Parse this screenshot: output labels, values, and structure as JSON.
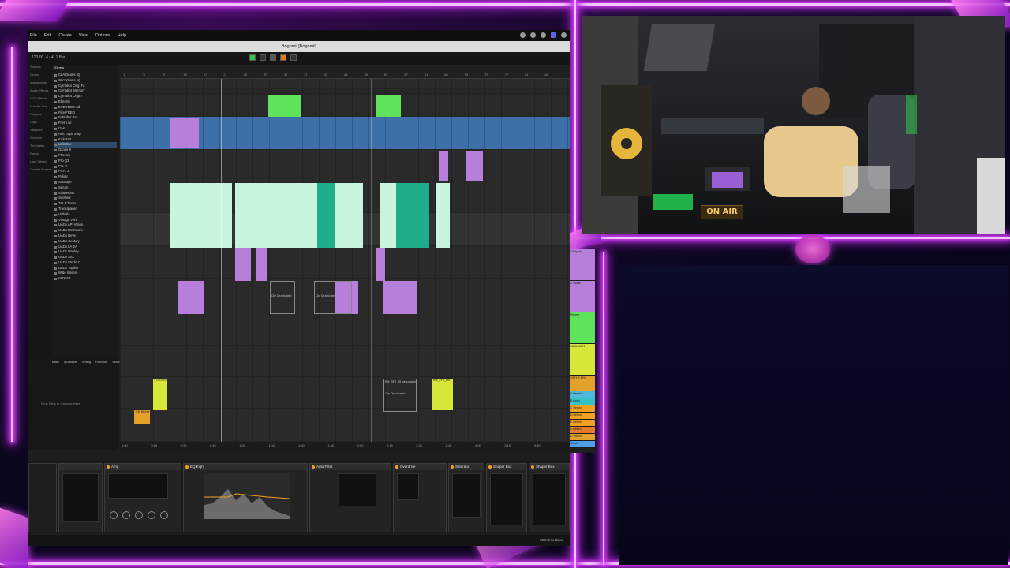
{
  "menubar": {
    "items": [
      "File",
      "Edit",
      "Create",
      "View",
      "Options",
      "Help"
    ]
  },
  "title": "Bogomil  [Bogomil]",
  "transport": {
    "tempo": "120.00",
    "signature": "4 / 4",
    "bar": "1 Bar"
  },
  "browser": {
    "header": "Name",
    "categories": [
      "Sounds",
      "Drums",
      "Instruments",
      "Audio Effects",
      "MIDI Effects",
      "Max for Live",
      "Plug-ins",
      "Clips",
      "Samples",
      "Grooves",
      "Templates",
      "Packs",
      "User Library",
      "Current Project"
    ],
    "items": [
      "CLA Drums (s)",
      "CLA Vocals (s)",
      "Cymatics Orig. Fa",
      "Cymatics Memory",
      "Cymatics Origin",
      "Effectrix",
      "EVENTIDE.vdl",
      "FilterFREQ",
      "FabFilter Pro",
      "Fresh Air",
      "Gain",
      "Halo Tape Stop",
      "Kickstart",
      "LittleOne",
      "Ozone 9",
      "Phoenix",
      "Pro-Q3",
      "Pro-R",
      "Pro-L 2",
      "Pulsar",
      "Sausage",
      "Serum",
      "Shaperbox",
      "Soothe2",
      "TAL-Chorus",
      "Trackspacer",
      "Valhalla",
      "Vintage Verb",
      "UADx API Vision",
      "UADx Brainworx",
      "UADx Neve",
      "UADx Century",
      "UADx LA-2A",
      "UADx Manley",
      "UADx SSL",
      "UADx Studio D",
      "UADx Topline",
      "Wide Stereo",
      "XLN XO"
    ],
    "selected_index": 13
  },
  "groove": {
    "columns": [
      "Base",
      "Quantize",
      "Timing",
      "Random",
      "Velocity"
    ],
    "drop_hint": "Drop Clips or Grooves Here"
  },
  "arrangement": {
    "ruler": [
      "1",
      "5",
      "9",
      "13",
      "17",
      "21",
      "25",
      "29",
      "33",
      "37",
      "41",
      "45",
      "49",
      "53",
      "57",
      "61",
      "65",
      "69",
      "73",
      "77",
      "81",
      "85"
    ],
    "clip_labels": {
      "deactivated_1": "Clip Deactivated",
      "deactivated_2": "Clip Deactivated",
      "deactivated_3": "Clip Deactivated",
      "perc_label": "RM_SFS_95_percussion",
      "vox_label": "1 CLOSED",
      "vox2_label": "RM_SFS_HH",
      "sub_label": "THE BRUH"
    },
    "timebar": [
      "0:00",
      "0:15",
      "0:30",
      "0:45",
      "1:00",
      "1:15",
      "1:30",
      "1:45",
      "2:00",
      "2:15",
      "2:30",
      "2:45",
      "3:00",
      "3:15",
      "3:30"
    ]
  },
  "mixer": {
    "tracks": [
      "16 Synth",
      "17 Bass",
      "Reverb",
      "18 CLOSED",
      "19 THE BRU",
      "A Reverb",
      "B Delay",
      "C Return",
      "D Return",
      "E Return",
      "F Return",
      "G Return",
      "Master"
    ]
  },
  "devices": {
    "items": [
      "Amp",
      "EQ Eight",
      "Auto Filter",
      "Overdrive",
      "Saturator",
      "Shaper Box",
      "Shaper Box"
    ]
  },
  "statusbar": {
    "text": "MIDI Info Base"
  },
  "webcam": {
    "sign": "ON AIR"
  },
  "colors": {
    "neon": "#e040ff",
    "green_clip": "#5fe35a",
    "blue_lane": "#3d6fa8",
    "purple_clip": "#b77fd9",
    "mint_clip": "#c9f5df",
    "teal_clip": "#1fae8a",
    "yellow_clip": "#d8e63a",
    "orange_clip": "#e3a12b"
  }
}
